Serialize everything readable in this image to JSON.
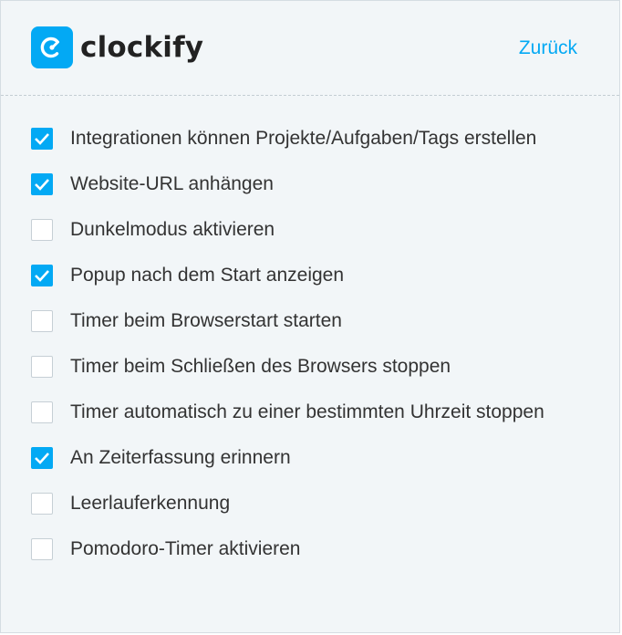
{
  "header": {
    "logo_text": "clockify",
    "logo_icon": "clockify-logo-icon",
    "back_label": "Zurück"
  },
  "colors": {
    "accent": "#03a9f4",
    "text": "#333333",
    "background": "#f2f6f8"
  },
  "settings": [
    {
      "label": "Integrationen können Projekte/Aufgaben/Tags erstellen",
      "checked": true
    },
    {
      "label": "Website-URL anhängen",
      "checked": true
    },
    {
      "label": "Dunkelmodus aktivieren",
      "checked": false
    },
    {
      "label": "Popup nach dem Start anzeigen",
      "checked": true
    },
    {
      "label": "Timer beim Browserstart starten",
      "checked": false
    },
    {
      "label": "Timer beim Schließen des Browsers stoppen",
      "checked": false
    },
    {
      "label": "Timer automatisch zu einer bestimmten Uhrzeit stoppen",
      "checked": false
    },
    {
      "label": "An Zeiterfassung erinnern",
      "checked": true
    },
    {
      "label": "Leerlauferkennung",
      "checked": false
    },
    {
      "label": "Pomodoro-Timer aktivieren",
      "checked": false
    }
  ]
}
